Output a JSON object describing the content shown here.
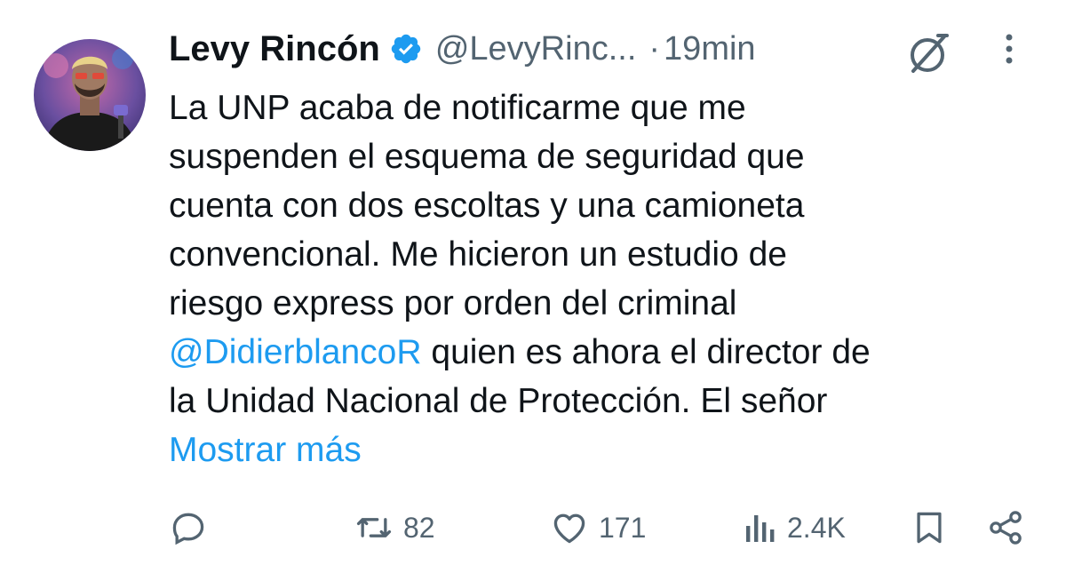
{
  "tweet": {
    "author_name": "Levy Rincón",
    "handle": "@LevyRinc...",
    "separator": "·",
    "time": "19min",
    "text_lines": [
      "La UNP acaba de notificarme que me",
      "suspenden el esquema de seguridad que",
      "cuenta con dos escoltas y una camioneta",
      "convencional. Me hicieron un estudio de",
      "riesgo express por orden del criminal"
    ],
    "mention": "@DidierblancoR",
    "line6_rest": " quien es ahora el director de",
    "line7": "la Unidad Nacional de Protección. El señor",
    "show_more": "Mostrar más"
  },
  "actions": {
    "reply_count": "",
    "retweet_count": "82",
    "like_count": "171",
    "views_count": "2.4K"
  },
  "icons": {
    "verified": "verified-badge-icon",
    "grok": "grok-icon",
    "more": "more-vertical-icon",
    "reply": "reply-icon",
    "retweet": "retweet-icon",
    "like": "heart-icon",
    "views": "views-icon",
    "bookmark": "bookmark-icon",
    "share": "share-icon"
  },
  "colors": {
    "accent": "#1d9bf0",
    "text": "#0f1419",
    "secondary": "#536471"
  }
}
